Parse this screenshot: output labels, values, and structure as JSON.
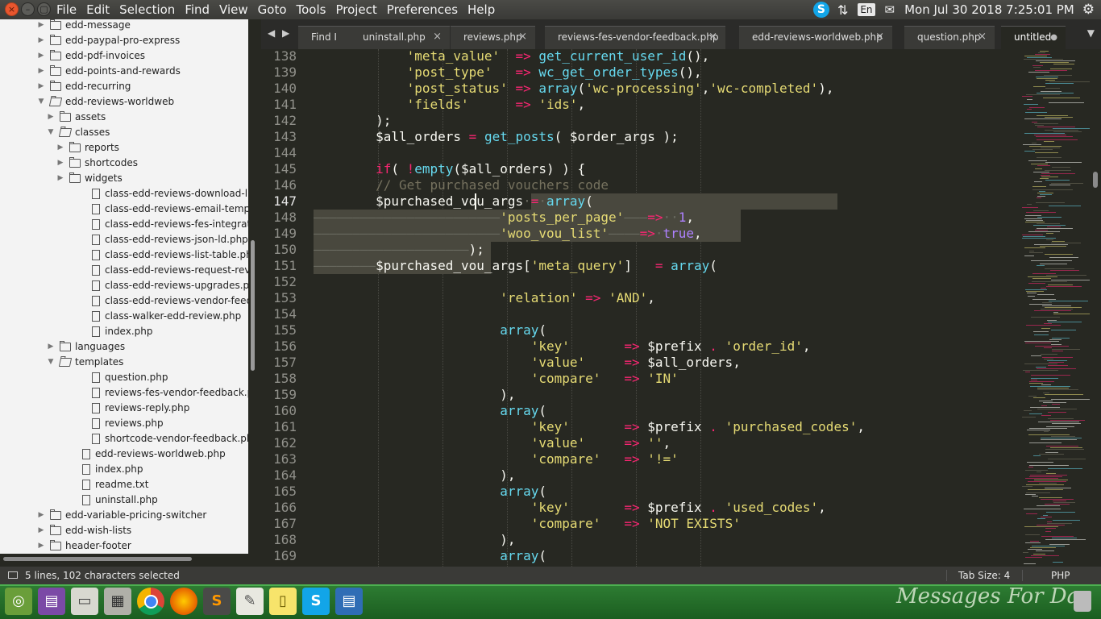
{
  "menubar": {
    "items": [
      "File",
      "Edit",
      "Selection",
      "Find",
      "View",
      "Goto",
      "Tools",
      "Project",
      "Preferences",
      "Help"
    ],
    "lang": "En",
    "clock": "Mon Jul 30 2018  7:25:01 PM"
  },
  "sidebar": {
    "items": [
      {
        "label": "edd-message",
        "type": "folder",
        "state": "closed",
        "depth": 0
      },
      {
        "label": "edd-paypal-pro-express",
        "type": "folder",
        "state": "closed",
        "depth": 0
      },
      {
        "label": "edd-pdf-invoices",
        "type": "folder",
        "state": "closed",
        "depth": 0
      },
      {
        "label": "edd-points-and-rewards",
        "type": "folder",
        "state": "closed",
        "depth": 0
      },
      {
        "label": "edd-recurring",
        "type": "folder",
        "state": "closed",
        "depth": 0
      },
      {
        "label": "edd-reviews-worldweb",
        "type": "folder",
        "state": "open",
        "depth": 0
      },
      {
        "label": "assets",
        "type": "folder",
        "state": "closed",
        "depth": 1
      },
      {
        "label": "classes",
        "type": "folder",
        "state": "open",
        "depth": 1
      },
      {
        "label": "reports",
        "type": "folder",
        "state": "closed",
        "depth": 2
      },
      {
        "label": "shortcodes",
        "type": "folder",
        "state": "closed",
        "depth": 2
      },
      {
        "label": "widgets",
        "type": "folder",
        "state": "closed",
        "depth": 2
      },
      {
        "label": "class-edd-reviews-download-list-table",
        "type": "file",
        "depth": 2
      },
      {
        "label": "class-edd-reviews-email-template-ta",
        "type": "file",
        "depth": 2
      },
      {
        "label": "class-edd-reviews-fes-integration.ph",
        "type": "file",
        "depth": 2
      },
      {
        "label": "class-edd-reviews-json-ld.php",
        "type": "file",
        "depth": 2
      },
      {
        "label": "class-edd-reviews-list-table.php",
        "type": "file",
        "depth": 2
      },
      {
        "label": "class-edd-reviews-request-review.ph",
        "type": "file",
        "depth": 2
      },
      {
        "label": "class-edd-reviews-upgrades.php",
        "type": "file",
        "depth": 2
      },
      {
        "label": "class-edd-reviews-vendor-feedback-",
        "type": "file",
        "depth": 2
      },
      {
        "label": "class-walker-edd-review.php",
        "type": "file",
        "depth": 2
      },
      {
        "label": "index.php",
        "type": "file",
        "depth": 2
      },
      {
        "label": "languages",
        "type": "folder",
        "state": "closed",
        "depth": 1
      },
      {
        "label": "templates",
        "type": "folder",
        "state": "open",
        "depth": 1
      },
      {
        "label": "question.php",
        "type": "file",
        "depth": 2
      },
      {
        "label": "reviews-fes-vendor-feedback.php",
        "type": "file",
        "depth": 2
      },
      {
        "label": "reviews-reply.php",
        "type": "file",
        "depth": 2
      },
      {
        "label": "reviews.php",
        "type": "file",
        "depth": 2
      },
      {
        "label": "shortcode-vendor-feedback.php",
        "type": "file",
        "depth": 2
      },
      {
        "label": "edd-reviews-worldweb.php",
        "type": "file",
        "depth": 1
      },
      {
        "label": "index.php",
        "type": "file",
        "depth": 1
      },
      {
        "label": "readme.txt",
        "type": "file",
        "depth": 1
      },
      {
        "label": "uninstall.php",
        "type": "file",
        "depth": 1
      },
      {
        "label": "edd-variable-pricing-switcher",
        "type": "folder",
        "state": "closed",
        "depth": 0
      },
      {
        "label": "edd-wish-lists",
        "type": "folder",
        "state": "closed",
        "depth": 0
      },
      {
        "label": "header-footer",
        "type": "folder",
        "state": "closed",
        "depth": 0
      }
    ]
  },
  "tabs": [
    {
      "label": "Find I",
      "closable": false,
      "active": false
    },
    {
      "label": "uninstall.php",
      "closable": true,
      "active": false
    },
    {
      "label": "reviews.php",
      "closable": true,
      "active": false
    },
    {
      "label": "reviews-fes-vendor-feedback.php",
      "closable": true,
      "active": false
    },
    {
      "label": "edd-reviews-worldweb.php",
      "closable": true,
      "active": false
    },
    {
      "label": "question.php",
      "closable": true,
      "active": false
    },
    {
      "label": "untitled",
      "closable": true,
      "active": true
    }
  ],
  "editor": {
    "current_line": 147,
    "lines": [
      {
        "n": 138,
        "t": [
          [
            "            ",
            "p"
          ],
          [
            "'meta_value'",
            "s"
          ],
          [
            "  ",
            "p"
          ],
          [
            "=>",
            "k"
          ],
          [
            " ",
            "p"
          ],
          [
            "get_current_user_id",
            "f"
          ],
          [
            "(),",
            "p"
          ]
        ]
      },
      {
        "n": 139,
        "t": [
          [
            "            ",
            "p"
          ],
          [
            "'post_type'",
            "s"
          ],
          [
            "   ",
            "p"
          ],
          [
            "=>",
            "k"
          ],
          [
            " ",
            "p"
          ],
          [
            "wc_get_order_types",
            "f"
          ],
          [
            "(),",
            "p"
          ]
        ]
      },
      {
        "n": 140,
        "t": [
          [
            "            ",
            "p"
          ],
          [
            "'post_status'",
            "s"
          ],
          [
            " ",
            "p"
          ],
          [
            "=>",
            "k"
          ],
          [
            " ",
            "p"
          ],
          [
            "array",
            "f"
          ],
          [
            "(",
            "p"
          ],
          [
            "'wc-processing'",
            "s"
          ],
          [
            ",",
            "p"
          ],
          [
            "'wc-completed'",
            "s"
          ],
          [
            "),",
            "p"
          ]
        ]
      },
      {
        "n": 141,
        "t": [
          [
            "            ",
            "p"
          ],
          [
            "'fields'",
            "s"
          ],
          [
            "      ",
            "p"
          ],
          [
            "=>",
            "k"
          ],
          [
            " ",
            "p"
          ],
          [
            "'ids'",
            "s"
          ],
          [
            ",",
            "p"
          ]
        ]
      },
      {
        "n": 142,
        "t": [
          [
            "        );",
            "p"
          ]
        ]
      },
      {
        "n": 143,
        "t": [
          [
            "        $all_orders ",
            "p"
          ],
          [
            "=",
            "k"
          ],
          [
            " ",
            "p"
          ],
          [
            "get_posts",
            "f"
          ],
          [
            "( $order_args );",
            "p"
          ]
        ]
      },
      {
        "n": 144,
        "t": []
      },
      {
        "n": 145,
        "t": [
          [
            "        ",
            "p"
          ],
          [
            "if",
            "k"
          ],
          [
            "( ",
            "p"
          ],
          [
            "!",
            "k"
          ],
          [
            "empty",
            "f"
          ],
          [
            "($all_orders) ) {",
            "p"
          ]
        ]
      },
      {
        "n": 146,
        "t": [
          [
            "        ",
            "p"
          ],
          [
            "// Get purchased vouchers code",
            "c"
          ]
        ]
      },
      {
        "n": 147,
        "t": [
          [
            "        $purchased_vou_args",
            "p"
          ],
          [
            "·",
            "ws"
          ],
          [
            "=",
            "k"
          ],
          [
            "·",
            "ws"
          ],
          [
            "array",
            "f"
          ],
          [
            "(",
            "p"
          ]
        ]
      },
      {
        "n": 148,
        "t": [
          [
            "————————————————————————",
            "ws"
          ],
          [
            "'posts_per_page'",
            "s"
          ],
          [
            "———",
            "ws"
          ],
          [
            "=>",
            "k"
          ],
          [
            "··",
            "ws"
          ],
          [
            "1",
            "n"
          ],
          [
            ",",
            "p"
          ]
        ]
      },
      {
        "n": 149,
        "t": [
          [
            "————————————————————————",
            "ws"
          ],
          [
            "'woo_vou_list'",
            "s"
          ],
          [
            "————",
            "ws"
          ],
          [
            "=>",
            "k"
          ],
          [
            "·",
            "ws"
          ],
          [
            "true",
            "n"
          ],
          [
            ",",
            "p"
          ]
        ]
      },
      {
        "n": 150,
        "t": [
          [
            "————————————————————",
            "ws"
          ],
          [
            ");",
            "p"
          ]
        ]
      },
      {
        "n": 151,
        "t": [
          [
            "————————",
            "ws"
          ],
          [
            "$purchased_vou_args[",
            "p"
          ],
          [
            "'meta_query'",
            "s"
          ],
          [
            "]   ",
            "p"
          ],
          [
            "=",
            "k"
          ],
          [
            " ",
            "p"
          ],
          [
            "array",
            "f"
          ],
          [
            "(",
            "p"
          ]
        ]
      },
      {
        "n": 152,
        "t": []
      },
      {
        "n": 153,
        "t": [
          [
            "                        ",
            "p"
          ],
          [
            "'relation'",
            "s"
          ],
          [
            " ",
            "p"
          ],
          [
            "=>",
            "k"
          ],
          [
            " ",
            "p"
          ],
          [
            "'AND'",
            "s"
          ],
          [
            ",",
            "p"
          ]
        ]
      },
      {
        "n": 154,
        "t": []
      },
      {
        "n": 155,
        "t": [
          [
            "                        ",
            "p"
          ],
          [
            "array",
            "f"
          ],
          [
            "(",
            "p"
          ]
        ]
      },
      {
        "n": 156,
        "t": [
          [
            "                            ",
            "p"
          ],
          [
            "'key'",
            "s"
          ],
          [
            "       ",
            "p"
          ],
          [
            "=>",
            "k"
          ],
          [
            " $prefix ",
            "p"
          ],
          [
            ".",
            "k"
          ],
          [
            " ",
            "p"
          ],
          [
            "'order_id'",
            "s"
          ],
          [
            ",",
            "p"
          ]
        ]
      },
      {
        "n": 157,
        "t": [
          [
            "                            ",
            "p"
          ],
          [
            "'value'",
            "s"
          ],
          [
            "     ",
            "p"
          ],
          [
            "=>",
            "k"
          ],
          [
            " $all_orders,",
            "p"
          ]
        ]
      },
      {
        "n": 158,
        "t": [
          [
            "                            ",
            "p"
          ],
          [
            "'compare'",
            "s"
          ],
          [
            "   ",
            "p"
          ],
          [
            "=>",
            "k"
          ],
          [
            " ",
            "p"
          ],
          [
            "'IN'",
            "s"
          ]
        ]
      },
      {
        "n": 159,
        "t": [
          [
            "                        ),",
            "p"
          ]
        ]
      },
      {
        "n": 160,
        "t": [
          [
            "                        ",
            "p"
          ],
          [
            "array",
            "f"
          ],
          [
            "(",
            "p"
          ]
        ]
      },
      {
        "n": 161,
        "t": [
          [
            "                            ",
            "p"
          ],
          [
            "'key'",
            "s"
          ],
          [
            "       ",
            "p"
          ],
          [
            "=>",
            "k"
          ],
          [
            " $prefix ",
            "p"
          ],
          [
            ".",
            "k"
          ],
          [
            " ",
            "p"
          ],
          [
            "'purchased_codes'",
            "s"
          ],
          [
            ",",
            "p"
          ]
        ]
      },
      {
        "n": 162,
        "t": [
          [
            "                            ",
            "p"
          ],
          [
            "'value'",
            "s"
          ],
          [
            "     ",
            "p"
          ],
          [
            "=>",
            "k"
          ],
          [
            " ",
            "p"
          ],
          [
            "''",
            "s"
          ],
          [
            ",",
            "p"
          ]
        ]
      },
      {
        "n": 163,
        "t": [
          [
            "                            ",
            "p"
          ],
          [
            "'compare'",
            "s"
          ],
          [
            "   ",
            "p"
          ],
          [
            "=>",
            "k"
          ],
          [
            " ",
            "p"
          ],
          [
            "'!='",
            "s"
          ]
        ]
      },
      {
        "n": 164,
        "t": [
          [
            "                        ),",
            "p"
          ]
        ]
      },
      {
        "n": 165,
        "t": [
          [
            "                        ",
            "p"
          ],
          [
            "array",
            "f"
          ],
          [
            "(",
            "p"
          ]
        ]
      },
      {
        "n": 166,
        "t": [
          [
            "                            ",
            "p"
          ],
          [
            "'key'",
            "s"
          ],
          [
            "       ",
            "p"
          ],
          [
            "=>",
            "k"
          ],
          [
            " $prefix ",
            "p"
          ],
          [
            ".",
            "k"
          ],
          [
            " ",
            "p"
          ],
          [
            "'used_codes'",
            "s"
          ],
          [
            ",",
            "p"
          ]
        ]
      },
      {
        "n": 167,
        "t": [
          [
            "                            ",
            "p"
          ],
          [
            "'compare'",
            "s"
          ],
          [
            "   ",
            "p"
          ],
          [
            "=>",
            "k"
          ],
          [
            " ",
            "p"
          ],
          [
            "'NOT EXISTS'",
            "s"
          ]
        ]
      },
      {
        "n": 168,
        "t": [
          [
            "                        ),",
            "p"
          ]
        ]
      },
      {
        "n": 169,
        "t": [
          [
            "                        ",
            "p"
          ],
          [
            "array",
            "f"
          ],
          [
            "(",
            "p"
          ]
        ]
      }
    ]
  },
  "statusbar": {
    "selection": "5 lines, 102 characters selected",
    "tab_size": "Tab Size: 4",
    "syntax": "PHP"
  },
  "taskbar": {
    "wallpaper_text": "Messages For Day",
    "skype_label": "S",
    "apps": [
      "ubuntu-icon",
      "files-icon",
      "drive-icon",
      "calculator-icon",
      "chrome-icon",
      "firefox-icon",
      "sublime-icon",
      "text-editor-icon",
      "notes-icon",
      "skype-icon",
      "document-icon"
    ]
  },
  "colors": {
    "background": "#272822",
    "keyword": "#f92672",
    "string": "#e6db74",
    "function": "#66d9ef",
    "number": "#ae81ff",
    "comment": "#75715e",
    "selection": "#49483e",
    "taskbar": "#1b5e20"
  }
}
